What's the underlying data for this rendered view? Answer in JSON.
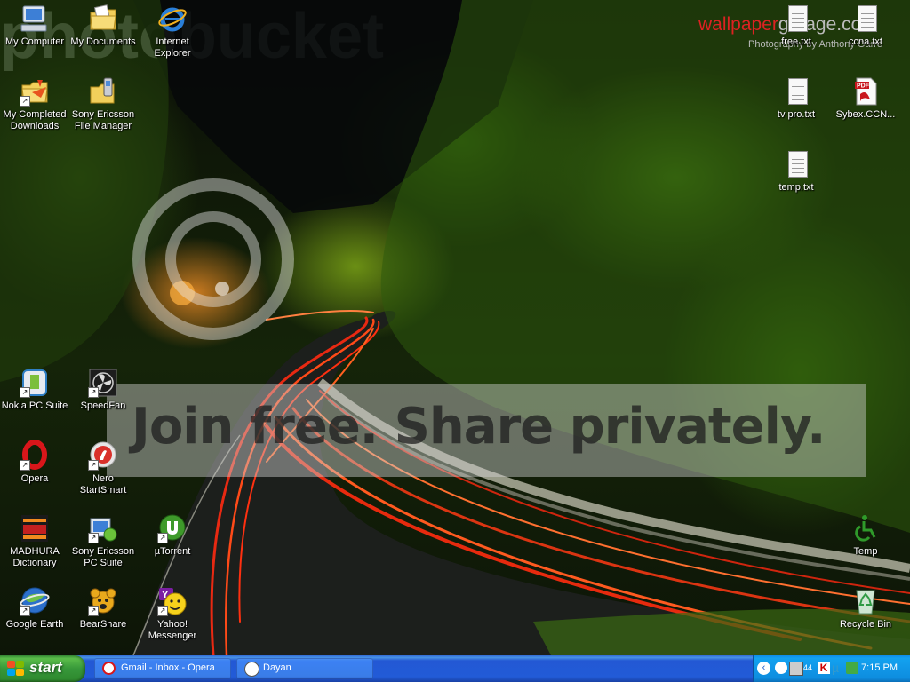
{
  "desktop_icons": {
    "my_computer": "My Computer",
    "my_documents": "My Documents",
    "internet_explorer": "Internet Explorer",
    "my_completed_downloads": "My Completed Downloads",
    "sony_ericsson_file_manager": "Sony Ericsson File Manager",
    "nokia_pc_suite": "Nokia PC Suite",
    "speedfan": "SpeedFan",
    "opera": "Opera",
    "nero_startsmart": "Nero StartSmart",
    "madhura_dictionary": "MADHURA Dictionary",
    "sony_ericsson_pc_suite": "Sony Ericsson PC Suite",
    "utorrent": "µTorrent",
    "google_earth": "Google Earth",
    "bearshare": "BearShare",
    "yahoo_messenger": "Yahoo! Messenger",
    "free_txt": "free.txt",
    "ccna_txt": "ccna.txt",
    "tv_pro_txt": "tv pro.txt",
    "sybex_ccna": "Sybex.CCN...",
    "temp_txt": "temp.txt",
    "temp": "Temp",
    "recycle_bin": "Recycle Bin"
  },
  "wallpaper": {
    "credit_brand_a": "wallpaper",
    "credit_brand_b": "garage.com",
    "credit_photo": "Photography by Anthony Garre",
    "watermark": "photobucket",
    "watermark_slogan": "Join free. Share privately."
  },
  "taskbar": {
    "start_label": "start",
    "tasks": [
      {
        "label": "Gmail - Inbox - Opera"
      },
      {
        "label": "Dayan"
      }
    ],
    "clock": "7:15 PM",
    "tray_counter": "44"
  },
  "colors": {
    "taskbar_blue": "#225bd7",
    "start_green": "#37983a",
    "tray_blue": "#0e8ddf"
  }
}
